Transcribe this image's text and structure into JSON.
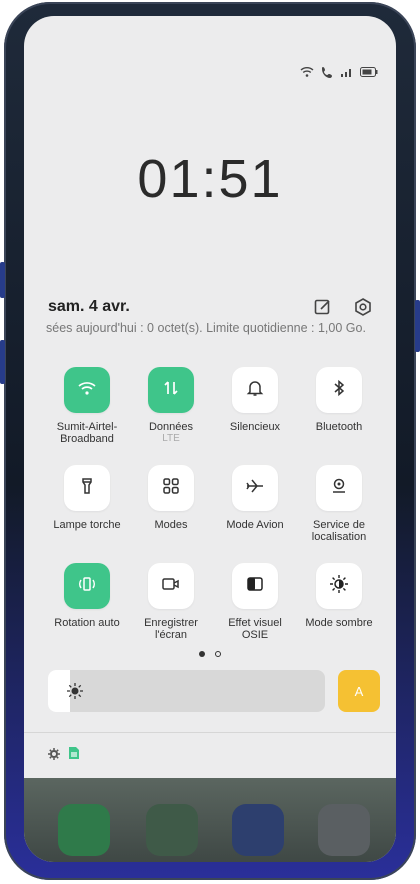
{
  "status": {
    "icons": [
      "wifi-icon",
      "call-icon",
      "signal-icon",
      "battery-icon"
    ]
  },
  "lockscreen": {
    "time": "01:51"
  },
  "panel": {
    "date": "sam. 4 avr.",
    "data_usage": "sées aujourd'hui : 0 octet(s). Limite quotidienne : 1,00 Go.",
    "top_icons": [
      "edit-icon",
      "settings-icon"
    ]
  },
  "tiles": [
    {
      "label": "Sumit-Airtel-Broadband",
      "sub": "",
      "icon": "wifi-icon",
      "active": true
    },
    {
      "label": "Données",
      "sub": "LTE",
      "icon": "data-transfer-icon",
      "active": true
    },
    {
      "label": "Silencieux",
      "sub": "",
      "icon": "bell-icon",
      "active": false
    },
    {
      "label": "Bluetooth",
      "sub": "",
      "icon": "bluetooth-icon",
      "active": false
    },
    {
      "label": "Lampe torche",
      "sub": "",
      "icon": "flashlight-icon",
      "active": false
    },
    {
      "label": "Modes",
      "sub": "",
      "icon": "modes-grid-icon",
      "active": false
    },
    {
      "label": "Mode Avion",
      "sub": "",
      "icon": "airplane-icon",
      "active": false
    },
    {
      "label": "Service de localisation",
      "sub": "",
      "icon": "location-icon",
      "active": false
    },
    {
      "label": "Rotation auto",
      "sub": "",
      "icon": "rotate-icon",
      "active": true
    },
    {
      "label": "Enregistrer l'écran",
      "sub": "",
      "icon": "screen-record-icon",
      "active": false
    },
    {
      "label": "Effet visuel OSIE",
      "sub": "",
      "icon": "visual-effect-icon",
      "active": false
    },
    {
      "label": "Mode sombre",
      "sub": "",
      "icon": "dark-mode-icon",
      "active": false
    }
  ],
  "pager": {
    "current": 1,
    "total": 2
  },
  "brightness": {
    "level": 0.08,
    "auto_label": "A"
  },
  "tray": [
    "settings-icon",
    "sim-icon"
  ],
  "colors": {
    "accent": "#3fc58a",
    "auto": "#f5c133"
  }
}
